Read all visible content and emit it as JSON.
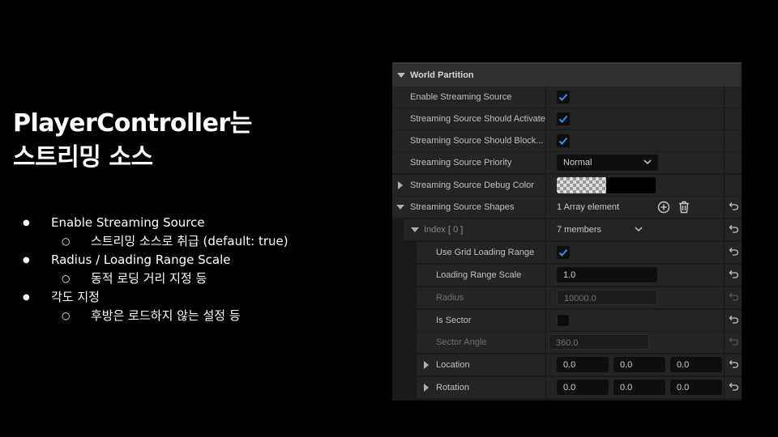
{
  "slide": {
    "title_line1": "PlayerController는",
    "title_line2": "스트리밍 소스",
    "bullets": [
      {
        "text": "Enable Streaming Source",
        "sub": "스트리밍 소스로 취급 (default: true)"
      },
      {
        "text": "Radius / Loading Range Scale",
        "sub": "동적 로딩 거리 지정 등"
      },
      {
        "text": "각도 지정",
        "sub": "후방은 로드하지 않는 설정 등"
      }
    ]
  },
  "panel": {
    "section_title": "World Partition",
    "rows": {
      "enable": {
        "label": "Enable Streaming Source",
        "checked": true
      },
      "should_activate": {
        "label": "Streaming Source Should Activate",
        "checked": true
      },
      "should_block": {
        "label": "Streaming Source Should Block...",
        "checked": true
      },
      "priority": {
        "label": "Streaming Source Priority",
        "value": "Normal"
      },
      "debug_color": {
        "label": "Streaming Source Debug Color"
      },
      "shapes": {
        "label": "Streaming Source Shapes",
        "value": "1 Array element"
      },
      "index": {
        "label": "Index [ 0 ]",
        "value": "7 members"
      },
      "use_grid": {
        "label": "Use Grid Loading Range",
        "checked": true
      },
      "loading_scale": {
        "label": "Loading Range Scale",
        "value": "1.0"
      },
      "radius": {
        "label": "Radius",
        "value": "10000.0"
      },
      "is_sector": {
        "label": "Is Sector",
        "checked": false
      },
      "sector_angle": {
        "label": "Sector Angle",
        "value": "360.0"
      },
      "location": {
        "label": "Location",
        "x": "0.0",
        "y": "0.0",
        "z": "0.0"
      },
      "rotation": {
        "label": "Rotation",
        "x": "0.0",
        "y": "0.0",
        "z": "0.0"
      }
    },
    "colors": {
      "check_blue": "#3a8ee6",
      "panel_bg": "#1a1a1a",
      "row_bg": "#242424"
    }
  }
}
